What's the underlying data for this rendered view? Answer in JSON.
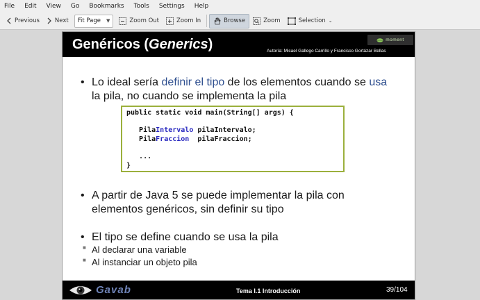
{
  "menubar": {
    "items": [
      "File",
      "Edit",
      "View",
      "Go",
      "Bookmarks",
      "Tools",
      "Settings",
      "Help"
    ]
  },
  "toolbar": {
    "previous": "Previous",
    "next": "Next",
    "zoom_mode": "Fit Page",
    "zoom_out": "Zoom Out",
    "zoom_in": "Zoom In",
    "browse": "Browse",
    "zoom": "Zoom",
    "selection": "Selection"
  },
  "slide": {
    "title_plain": "Genéricos (",
    "title_italic": "Generics",
    "title_close": ")",
    "logo_text": "moment",
    "author": "Autoría: Micael Gallego Carrillo y Francisco Gortázar Bellas",
    "bullet1": {
      "a": "Lo ideal sería ",
      "b": "definir el tipo",
      "c": " de los elementos cuando se ",
      "d": "usa",
      "e": " la pila, no cuando se implementa la pila"
    },
    "code": {
      "line1": "public static void main(String[] args) {",
      "line2_a": "   Pila",
      "line2_b": "Intervalo",
      "line2_c": " pilaIntervalo;",
      "line3_a": "   Pila",
      "line3_b": "Fraccion",
      "line3_c": "  pilaFraccion;",
      "line4": "   ...",
      "line5": "}"
    },
    "bullet2": "A partir de Java 5 se puede implementar la pila con elementos genéricos, sin definir su tipo",
    "bullet3": "El tipo se define cuando se usa la pila",
    "sub1": "Al declarar una variable",
    "sub2": "Al instanciar un objeto pila",
    "footer": {
      "brand": "Gavab",
      "topic": "Tema I.1 Introducción",
      "page": "39/104"
    }
  },
  "colors": {
    "accent_blue": "#2f4f8f",
    "code_border": "#9bb03c",
    "slide_bar": "#000000"
  }
}
